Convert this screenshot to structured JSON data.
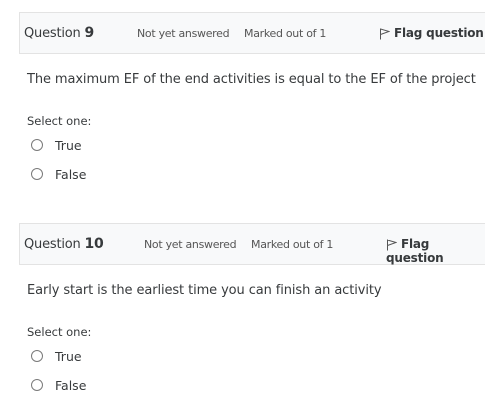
{
  "questions": [
    {
      "label": "Question",
      "number": "9",
      "state": "Not yet answered",
      "grade": "Marked out of 1",
      "flag_label": "Flag question",
      "text": "The maximum  EF of the end activities is equal to the EF of the project",
      "prompt": "Select one:",
      "options": [
        "True",
        "False"
      ]
    },
    {
      "label": "Question",
      "number": "10",
      "state": "Not yet answered",
      "grade": "Marked out of 1",
      "flag_label": "Flag question",
      "text": "Early start is the earliest time you can finish an activity",
      "prompt": "Select one:",
      "options": [
        "True",
        "False"
      ]
    }
  ]
}
